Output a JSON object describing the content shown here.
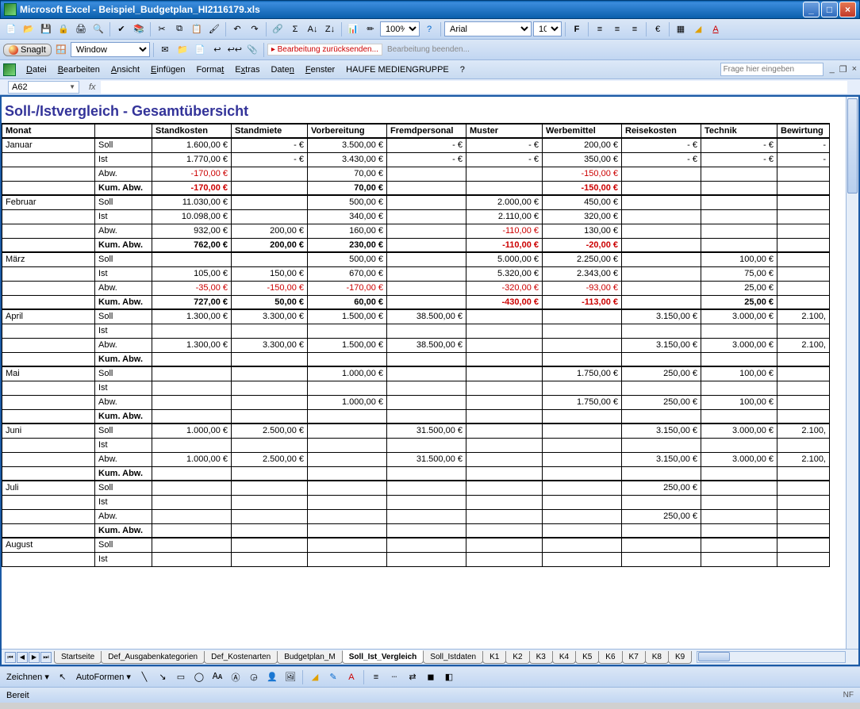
{
  "window": {
    "title": "Microsoft Excel - Beispiel_Budgetplan_HI2116179.xls"
  },
  "toolbar1": {
    "zoom": "100%",
    "font": "Arial",
    "size": "10"
  },
  "toolbar2": {
    "snagit": "SnagIt",
    "windowCapture": "Window",
    "review_return": "Bearbeitung zurücksenden...",
    "review_end": "Bearbeitung beenden..."
  },
  "menu": {
    "file": "Datei",
    "edit": "Bearbeiten",
    "view": "Ansicht",
    "insert": "Einfügen",
    "format": "Format",
    "extras": "Extras",
    "data": "Daten",
    "window": "Fenster",
    "haufe": "HAUFE MEDIENGRUPPE",
    "help": "?",
    "helpPlaceholder": "Frage hier eingeben"
  },
  "formula": {
    "nameBox": "A62",
    "fx": "fx"
  },
  "sheet": {
    "title": "Soll-/Istvergleich - Gesamtübersicht",
    "headerRow": [
      "Monat",
      "",
      "Standkosten",
      "Standmiete",
      "Vorbereitung",
      "Fremdpersonal",
      "Muster",
      "Werbemittel",
      "Reisekosten",
      "Technik",
      "Bewirtung"
    ],
    "rowLabels": {
      "soll": "Soll",
      "ist": "Ist",
      "abw": "Abw.",
      "kum": "Kum. Abw."
    },
    "months": [
      {
        "name": "Januar",
        "soll": [
          "1.600,00 €",
          "-   €",
          "3.500,00 €",
          "-   €",
          "-   €",
          "200,00 €",
          "-   €",
          "-   €",
          "-"
        ],
        "ist": [
          "1.770,00 €",
          "-   €",
          "3.430,00 €",
          "-   €",
          "-   €",
          "350,00 €",
          "-   €",
          "-   €",
          "-"
        ],
        "abw": [
          "-170,00 €",
          "",
          "70,00 €",
          "",
          "",
          "-150,00 €",
          "",
          "",
          ""
        ],
        "abwNeg": [
          true,
          false,
          false,
          false,
          false,
          true,
          false,
          false,
          false
        ],
        "kum": [
          "-170,00 €",
          "",
          "70,00 €",
          "",
          "",
          "-150,00 €",
          "",
          "",
          ""
        ],
        "kumNeg": [
          true,
          false,
          false,
          false,
          false,
          true,
          false,
          false,
          false
        ]
      },
      {
        "name": "Februar",
        "soll": [
          "11.030,00 €",
          "",
          "500,00 €",
          "",
          "2.000,00 €",
          "450,00 €",
          "",
          "",
          ""
        ],
        "ist": [
          "10.098,00 €",
          "",
          "340,00 €",
          "",
          "2.110,00 €",
          "320,00 €",
          "",
          "",
          ""
        ],
        "abw": [
          "932,00 €",
          "200,00 €",
          "160,00 €",
          "",
          "-110,00 €",
          "130,00 €",
          "",
          "",
          ""
        ],
        "abwNeg": [
          false,
          false,
          false,
          false,
          true,
          false,
          false,
          false,
          false
        ],
        "kum": [
          "762,00 €",
          "200,00 €",
          "230,00 €",
          "",
          "-110,00 €",
          "-20,00 €",
          "",
          "",
          ""
        ],
        "kumNeg": [
          false,
          false,
          false,
          false,
          true,
          true,
          false,
          false,
          false
        ]
      },
      {
        "name": "März",
        "soll": [
          "",
          "",
          "500,00 €",
          "",
          "5.000,00 €",
          "2.250,00 €",
          "",
          "100,00 €",
          ""
        ],
        "ist": [
          "105,00 €",
          "150,00 €",
          "670,00 €",
          "",
          "5.320,00 €",
          "2.343,00 €",
          "",
          "75,00 €",
          ""
        ],
        "abw": [
          "-35,00 €",
          "-150,00 €",
          "-170,00 €",
          "",
          "-320,00 €",
          "-93,00 €",
          "",
          "25,00 €",
          ""
        ],
        "abwNeg": [
          true,
          true,
          true,
          false,
          true,
          true,
          false,
          false,
          false
        ],
        "kum": [
          "727,00 €",
          "50,00 €",
          "60,00 €",
          "",
          "-430,00 €",
          "-113,00 €",
          "",
          "25,00 €",
          ""
        ],
        "kumNeg": [
          false,
          false,
          false,
          false,
          true,
          true,
          false,
          false,
          false
        ]
      },
      {
        "name": "April",
        "soll": [
          "1.300,00 €",
          "3.300,00 €",
          "1.500,00 €",
          "38.500,00 €",
          "",
          "",
          "3.150,00 €",
          "3.000,00 €",
          "2.100,"
        ],
        "ist": [
          "",
          "",
          "",
          "",
          "",
          "",
          "",
          "",
          ""
        ],
        "abw": [
          "1.300,00 €",
          "3.300,00 €",
          "1.500,00 €",
          "38.500,00 €",
          "",
          "",
          "3.150,00 €",
          "3.000,00 €",
          "2.100,"
        ],
        "abwNeg": [
          false,
          false,
          false,
          false,
          false,
          false,
          false,
          false,
          false
        ],
        "kum": [
          "",
          "",
          "",
          "",
          "",
          "",
          "",
          "",
          ""
        ],
        "kumNeg": [
          false,
          false,
          false,
          false,
          false,
          false,
          false,
          false,
          false
        ]
      },
      {
        "name": "Mai",
        "soll": [
          "",
          "",
          "1.000,00 €",
          "",
          "",
          "1.750,00 €",
          "250,00 €",
          "100,00 €",
          ""
        ],
        "ist": [
          "",
          "",
          "",
          "",
          "",
          "",
          "",
          "",
          ""
        ],
        "abw": [
          "",
          "",
          "1.000,00 €",
          "",
          "",
          "1.750,00 €",
          "250,00 €",
          "100,00 €",
          ""
        ],
        "abwNeg": [
          false,
          false,
          false,
          false,
          false,
          false,
          false,
          false,
          false
        ],
        "kum": [
          "",
          "",
          "",
          "",
          "",
          "",
          "",
          "",
          ""
        ],
        "kumNeg": [
          false,
          false,
          false,
          false,
          false,
          false,
          false,
          false,
          false
        ]
      },
      {
        "name": "Juni",
        "soll": [
          "1.000,00 €",
          "2.500,00 €",
          "",
          "31.500,00 €",
          "",
          "",
          "3.150,00 €",
          "3.000,00 €",
          "2.100,"
        ],
        "ist": [
          "",
          "",
          "",
          "",
          "",
          "",
          "",
          "",
          ""
        ],
        "abw": [
          "1.000,00 €",
          "2.500,00 €",
          "",
          "31.500,00 €",
          "",
          "",
          "3.150,00 €",
          "3.000,00 €",
          "2.100,"
        ],
        "abwNeg": [
          false,
          false,
          false,
          false,
          false,
          false,
          false,
          false,
          false
        ],
        "kum": [
          "",
          "",
          "",
          "",
          "",
          "",
          "",
          "",
          ""
        ],
        "kumNeg": [
          false,
          false,
          false,
          false,
          false,
          false,
          false,
          false,
          false
        ]
      },
      {
        "name": "Juli",
        "soll": [
          "",
          "",
          "",
          "",
          "",
          "",
          "250,00 €",
          "",
          ""
        ],
        "ist": [
          "",
          "",
          "",
          "",
          "",
          "",
          "",
          "",
          ""
        ],
        "abw": [
          "",
          "",
          "",
          "",
          "",
          "",
          "250,00 €",
          "",
          ""
        ],
        "abwNeg": [
          false,
          false,
          false,
          false,
          false,
          false,
          false,
          false,
          false
        ],
        "kum": [
          "",
          "",
          "",
          "",
          "",
          "",
          "",
          "",
          ""
        ],
        "kumNeg": [
          false,
          false,
          false,
          false,
          false,
          false,
          false,
          false,
          false
        ]
      },
      {
        "name": "August",
        "soll": [
          "",
          "",
          "",
          "",
          "",
          "",
          "",
          "",
          ""
        ],
        "ist": [
          "",
          "",
          "",
          "",
          "",
          "",
          "",
          "",
          ""
        ]
      }
    ]
  },
  "tabs": {
    "items": [
      "Startseite",
      "Def_Ausgabenkategorien",
      "Def_Kostenarten",
      "Budgetplan_M",
      "Soll_Ist_Vergleich",
      "Soll_Istdaten",
      "K1",
      "K2",
      "K3",
      "K4",
      "K5",
      "K6",
      "K7",
      "K8",
      "K9"
    ],
    "active": 4
  },
  "draw": {
    "label": "Zeichnen",
    "autoshapes": "AutoFormen"
  },
  "status": {
    "ready": "Bereit",
    "nf": "NF"
  }
}
